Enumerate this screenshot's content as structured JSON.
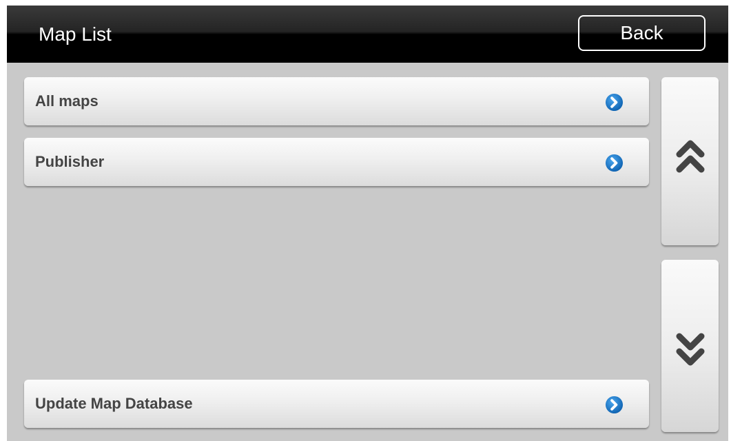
{
  "header": {
    "title": "Map List",
    "back_label": "Back"
  },
  "list": {
    "items": [
      {
        "label": "All maps",
        "icon": "chevron-right-circle-icon"
      },
      {
        "label": "Publisher",
        "icon": "chevron-right-circle-icon"
      }
    ],
    "footer_item": {
      "label": "Update Map Database",
      "icon": "chevron-right-circle-icon"
    }
  },
  "scroll": {
    "up_icon": "double-chevron-up-icon",
    "down_icon": "double-chevron-down-icon"
  },
  "colors": {
    "accent_blue": "#1e74c6",
    "background": "#c9c9c9",
    "header": "#000000",
    "label_text": "#444444",
    "scroll_chevron": "#444444"
  }
}
